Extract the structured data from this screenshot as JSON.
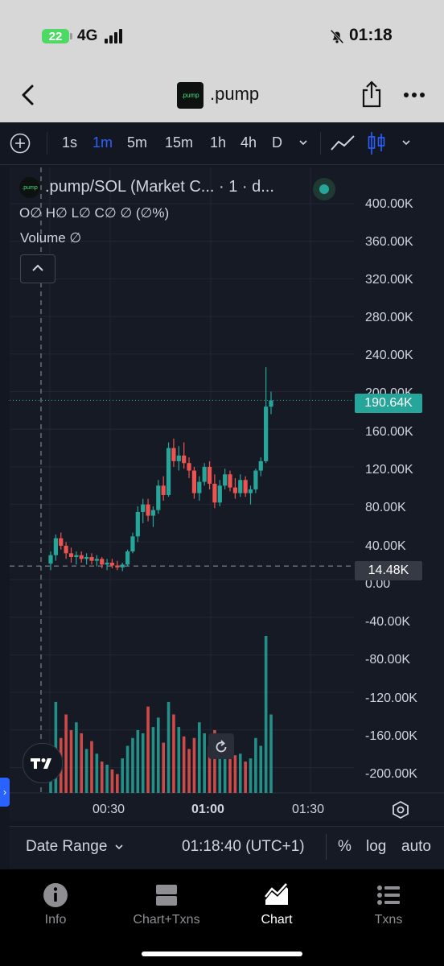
{
  "status_bar": {
    "battery": "22",
    "network": "4G",
    "time": "01:18"
  },
  "header": {
    "token_logo_text": ".pump",
    "title": ".pump"
  },
  "toolbar": {
    "intervals": [
      "1s",
      "1m",
      "5m",
      "15m",
      "1h",
      "4h",
      "D"
    ],
    "active_interval": "1m"
  },
  "legend": {
    "logo_text": ".pump",
    "title": ".pump/SOL (Market C...  · 1 · d...",
    "ohlc": "O∅  H∅  L∅  C∅  ∅ (∅%)",
    "volume": "Volume   ∅"
  },
  "price_axis": {
    "labels": [
      "400.00K",
      "360.00K",
      "320.00K",
      "280.00K",
      "240.00K",
      "200.00K",
      "160.00K",
      "120.00K",
      "80.00K",
      "40.00K",
      "0.00",
      "-40.00K",
      "-80.00K",
      "-120.00K",
      "-160.00K",
      "-200.00K"
    ],
    "last_price": "190.64K",
    "crosshair_price": "14.48K"
  },
  "time_axis": {
    "labels": [
      "00:30",
      "01:00",
      "01:30"
    ]
  },
  "chart_data": {
    "type": "candlestick",
    "pair": ".pump/SOL (Market Cap)",
    "interval": "1m",
    "y_axis_range": [
      -220000,
      420000
    ],
    "last_price": 190640,
    "crosshair_value": 14480,
    "up_color": "#26a69a",
    "down_color": "#ef5350",
    "candles": [
      [
        17000,
        30000,
        10000,
        26000
      ],
      [
        26000,
        48000,
        20000,
        44000
      ],
      [
        44000,
        50000,
        32000,
        36000
      ],
      [
        36000,
        40000,
        22000,
        28000
      ],
      [
        28000,
        34000,
        18000,
        24000
      ],
      [
        24000,
        30000,
        16000,
        26000
      ],
      [
        26000,
        30000,
        18000,
        22000
      ],
      [
        22000,
        28000,
        16000,
        24000
      ],
      [
        24000,
        28000,
        16000,
        20000
      ],
      [
        20000,
        26000,
        14000,
        22000
      ],
      [
        22000,
        24000,
        12000,
        16000
      ],
      [
        16000,
        22000,
        10000,
        18000
      ],
      [
        18000,
        22000,
        12000,
        15000
      ],
      [
        15000,
        20000,
        10000,
        13000
      ],
      [
        13000,
        18000,
        9000,
        16000
      ],
      [
        16000,
        32000,
        14000,
        30000
      ],
      [
        30000,
        50000,
        28000,
        46000
      ],
      [
        46000,
        78000,
        40000,
        72000
      ],
      [
        72000,
        86000,
        60000,
        80000
      ],
      [
        80000,
        86000,
        62000,
        68000
      ],
      [
        68000,
        78000,
        56000,
        74000
      ],
      [
        74000,
        106000,
        70000,
        100000
      ],
      [
        100000,
        110000,
        84000,
        90000
      ],
      [
        90000,
        146000,
        88000,
        140000
      ],
      [
        140000,
        150000,
        120000,
        126000
      ],
      [
        126000,
        142000,
        116000,
        132000
      ],
      [
        132000,
        146000,
        118000,
        124000
      ],
      [
        124000,
        130000,
        108000,
        116000
      ],
      [
        116000,
        120000,
        86000,
        92000
      ],
      [
        92000,
        110000,
        84000,
        104000
      ],
      [
        104000,
        124000,
        100000,
        120000
      ],
      [
        120000,
        126000,
        96000,
        102000
      ],
      [
        102000,
        112000,
        76000,
        82000
      ],
      [
        82000,
        106000,
        78000,
        100000
      ],
      [
        100000,
        118000,
        96000,
        112000
      ],
      [
        112000,
        116000,
        94000,
        98000
      ],
      [
        98000,
        108000,
        86000,
        92000
      ],
      [
        92000,
        112000,
        88000,
        106000
      ],
      [
        106000,
        110000,
        88000,
        92000
      ],
      [
        92000,
        100000,
        80000,
        96000
      ],
      [
        96000,
        118000,
        92000,
        116000
      ],
      [
        116000,
        130000,
        110000,
        126000
      ],
      [
        126000,
        226000,
        124000,
        184000
      ],
      [
        184000,
        200000,
        176000,
        190640
      ]
    ],
    "volume": [
      20,
      58,
      35,
      50,
      40,
      45,
      38,
      28,
      33,
      25,
      20,
      18,
      15,
      12,
      22,
      30,
      35,
      40,
      38,
      55,
      42,
      48,
      32,
      58,
      50,
      42,
      36,
      28,
      35,
      45,
      38,
      30,
      40,
      28,
      33,
      30,
      24,
      25,
      20,
      22,
      35,
      30,
      100,
      50
    ]
  },
  "bottom_toolbar": {
    "date_range": "Date Range",
    "time": "01:18:40 (UTC+1)",
    "percent": "%",
    "log": "log",
    "auto": "auto"
  },
  "tabs": [
    {
      "label": "Info",
      "icon": "info-icon"
    },
    {
      "label": "Chart+Txns",
      "icon": "split-view-icon"
    },
    {
      "label": "Chart",
      "icon": "chart-icon"
    },
    {
      "label": "Txns",
      "icon": "list-icon"
    }
  ],
  "colors": {
    "up": "#26a69a",
    "down": "#ef5350",
    "accent": "#2962ff",
    "last_price_tag": "#26a69a"
  }
}
